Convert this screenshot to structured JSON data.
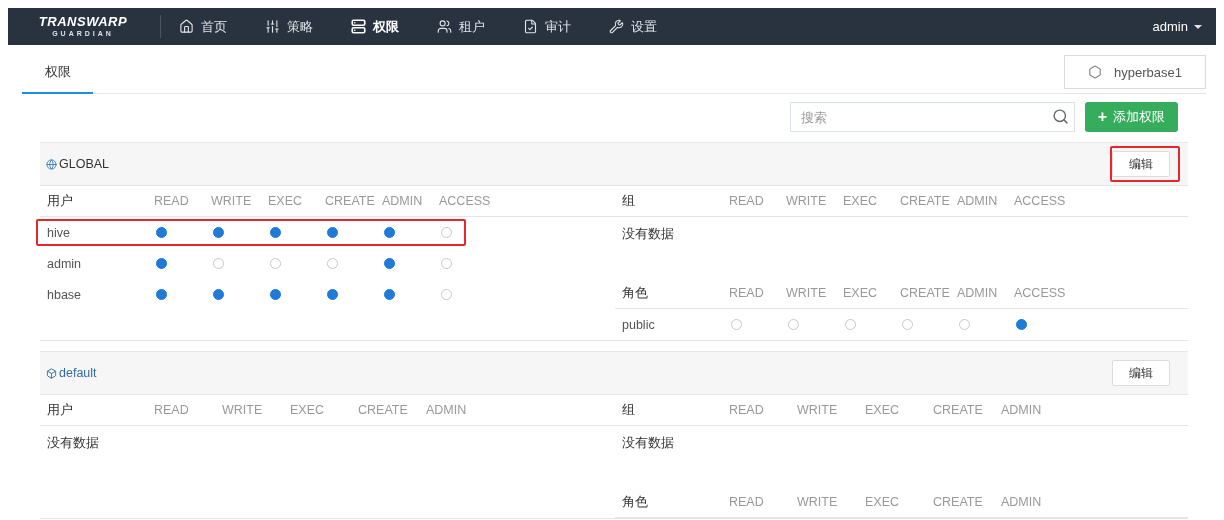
{
  "navbar": {
    "logo": {
      "title": "TRANSWARP",
      "subtitle": "GUARDIAN"
    },
    "items": [
      {
        "label": "首页",
        "selected": false
      },
      {
        "label": "策略",
        "selected": false
      },
      {
        "label": "权限",
        "selected": true
      },
      {
        "label": "租户",
        "selected": false
      },
      {
        "label": "审计",
        "selected": false
      },
      {
        "label": "设置",
        "selected": false
      }
    ],
    "user": "admin"
  },
  "tabs": [
    {
      "label": "权限",
      "selected": true
    }
  ],
  "service": "hyperbase1",
  "search": {
    "placeholder": "搜索"
  },
  "add_button": {
    "icon": "+",
    "label": "添加权限"
  },
  "sections": [
    {
      "name": "GLOBAL",
      "kind": "global",
      "edit": {
        "label": "编辑",
        "highlighted": true
      },
      "users": {
        "header": "用户",
        "columns": [
          "READ",
          "WRITE",
          "EXEC",
          "CREATE",
          "ADMIN",
          "ACCESS"
        ],
        "rows": [
          {
            "name": "hive",
            "highlighted": true,
            "permissions": [
              true,
              true,
              true,
              true,
              true,
              false
            ]
          },
          {
            "name": "admin",
            "highlighted": false,
            "permissions": [
              true,
              false,
              false,
              false,
              true,
              false
            ]
          },
          {
            "name": "hbase",
            "highlighted": false,
            "permissions": [
              true,
              true,
              true,
              true,
              true,
              false
            ]
          }
        ]
      },
      "groups": {
        "header": "组",
        "columns": [
          "READ",
          "WRITE",
          "EXEC",
          "CREATE",
          "ADMIN",
          "ACCESS"
        ],
        "empty_text": "没有数据"
      },
      "roles": {
        "header": "角色",
        "columns": [
          "READ",
          "WRITE",
          "EXEC",
          "CREATE",
          "ADMIN",
          "ACCESS"
        ],
        "rows": [
          {
            "name": "public",
            "highlighted": false,
            "permissions": [
              false,
              false,
              false,
              false,
              false,
              true
            ]
          }
        ]
      }
    },
    {
      "name": "default",
      "kind": "database",
      "edit": {
        "label": "编辑",
        "highlighted": false
      },
      "users": {
        "header": "用户",
        "columns": [
          "READ",
          "WRITE",
          "EXEC",
          "CREATE",
          "ADMIN"
        ],
        "empty_text": "没有数据"
      },
      "groups": {
        "header": "组",
        "columns": [
          "READ",
          "WRITE",
          "EXEC",
          "CREATE",
          "ADMIN"
        ],
        "empty_text": "没有数据"
      },
      "roles": {
        "header": "角色",
        "columns": [
          "READ",
          "WRITE",
          "EXEC",
          "CREATE",
          "ADMIN"
        ]
      }
    }
  ]
}
